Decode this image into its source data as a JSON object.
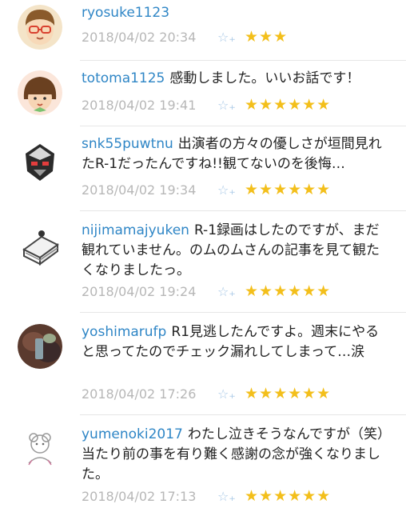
{
  "comments": [
    {
      "user": "ryosuke1123",
      "text": "",
      "time": "2018/04/02 20:34",
      "stars": "★★★"
    },
    {
      "user": "totoma1125",
      "text": "感動しました。いいお話です！",
      "time": "2018/04/02 19:41",
      "stars": "★★★★★★"
    },
    {
      "user": "snk55puwtnu",
      "text": "出演者の方々の優しさが垣間見れたR-1だったんですね!!観てないのを後悔…",
      "time": "2018/04/02 19:34",
      "stars": "★★★★★★"
    },
    {
      "user": "nijimamajyuken",
      "text": "R-1録画はしたのですが、まだ観れていません。のムのムさんの記事を見て観たくなりましたっ。",
      "time": "2018/04/02 19:24",
      "stars": "★★★★★★"
    },
    {
      "user": "yoshimarufp",
      "text": "R1見逃したんですよ。週末にやると思ってたのでチェック漏れしてしまって…涙",
      "time": "2018/04/02 17:26",
      "stars": "★★★★★★"
    },
    {
      "user": "yumenoki2017",
      "text": "わたし泣きそうなんですが（笑）当たり前の事を有り難く感謝の念が強くなりました。",
      "time": "2018/04/02 17:13",
      "stars": "★★★★★★"
    }
  ],
  "icons": {
    "star_plus": "☆₊"
  }
}
